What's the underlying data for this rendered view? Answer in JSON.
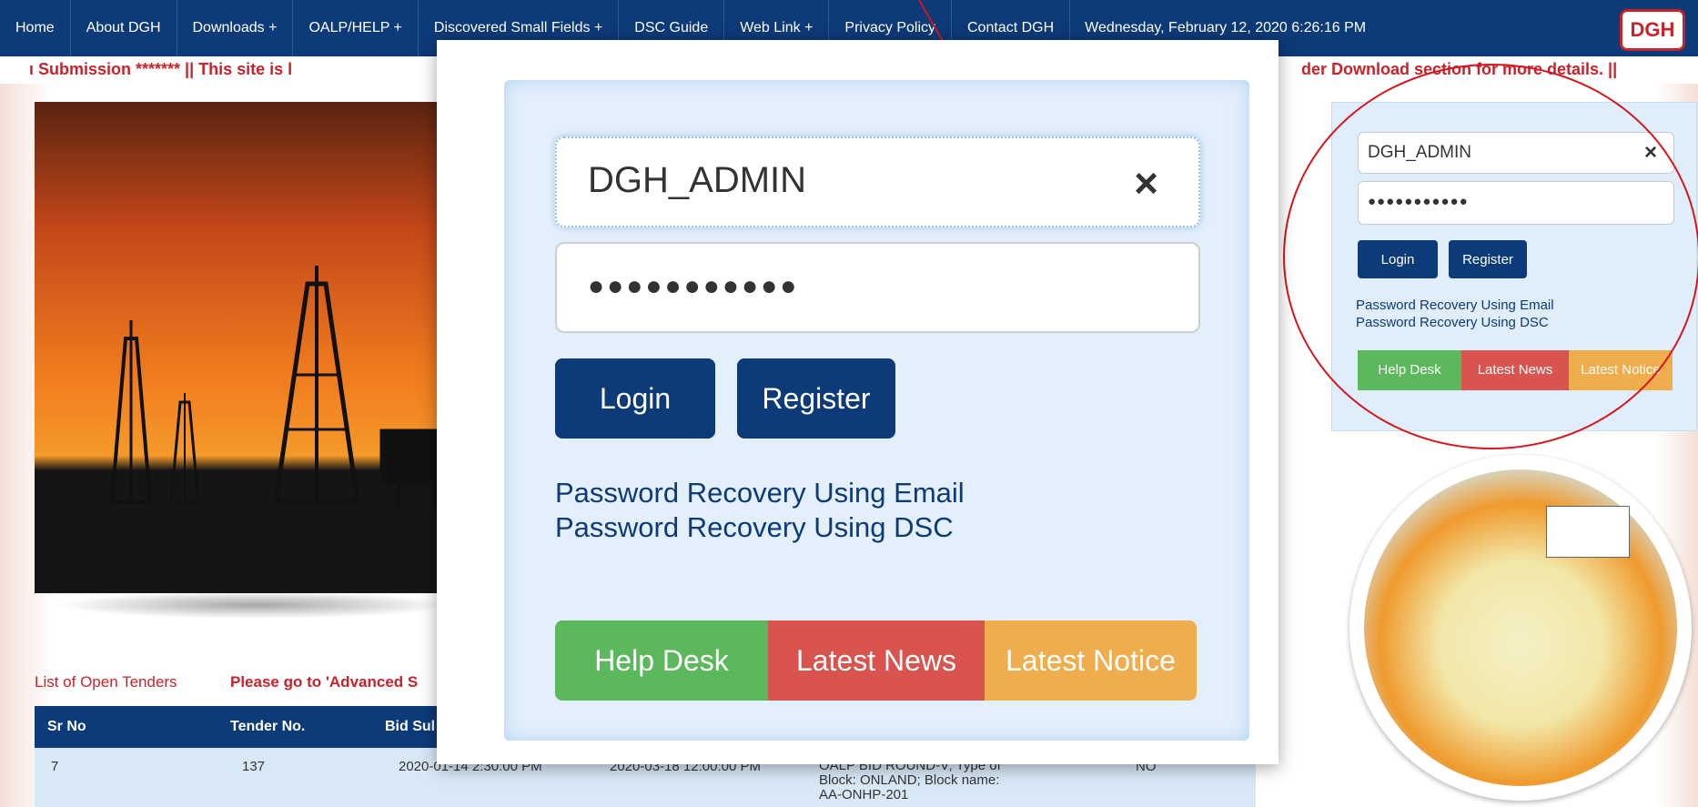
{
  "nav": {
    "items": [
      "Home",
      "About DGH",
      "Downloads +",
      "OALP/HELP +",
      "Discovered Small Fields +",
      "DSC Guide",
      "Web Link +",
      "Privacy Policy",
      "Contact DGH"
    ],
    "datetime": "Wednesday, February 12, 2020 6:26:16 PM",
    "logo": "DGH"
  },
  "ticker": {
    "left": "ι Submission *******    ||    This site is l",
    "right": "der Download section for more details.    ||"
  },
  "tenders": {
    "title": "List of Open Tenders",
    "note": "Please go to 'Advanced S",
    "headers": [
      "Sr No",
      "Tender No.",
      "Bid Sul"
    ],
    "row": {
      "sr": "7",
      "tender": "137",
      "bid_start": "2020-01-14 2:30:00 PM",
      "bid_end": "2020-03-18 12:00:00 PM",
      "desc": "OALP BID ROUND-V; Type of Block: ONLAND; Block name: AA-ONHP-201",
      "flag": "NO"
    }
  },
  "login": {
    "username": "DGH_ADMIN",
    "password_mask": "●●●●●●●●●●●",
    "clear": "×",
    "login_label": "Login",
    "register_label": "Register",
    "recovery_email": "Password Recovery Using Email",
    "recovery_dsc": "Password Recovery Using DSC",
    "tabs": [
      "Help Desk",
      "Latest News",
      "Latest Notice"
    ]
  },
  "colors": {
    "navy": "#0d3a78",
    "green": "#5cb85c",
    "red": "#d9534f",
    "orange": "#f0ad4e",
    "alert_red": "#c8232b"
  }
}
